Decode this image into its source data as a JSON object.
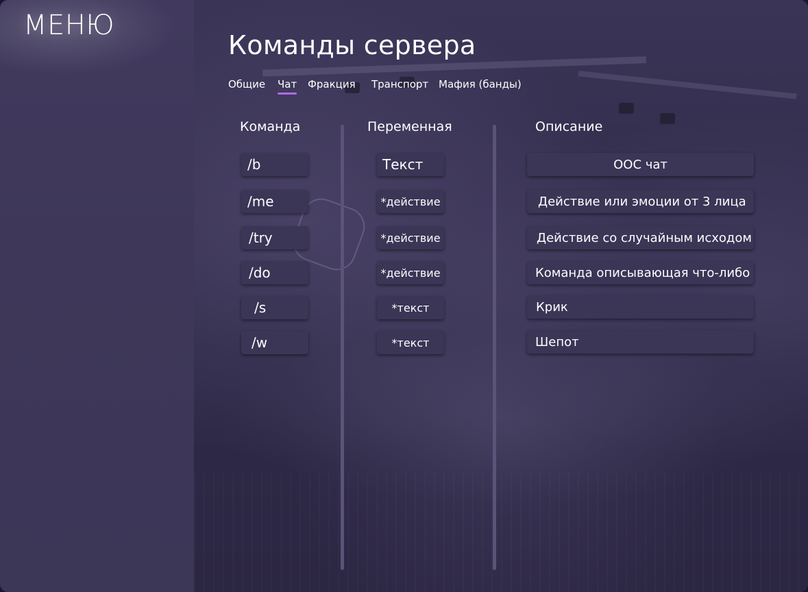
{
  "sidebar": {
    "title": "МЕНЮ"
  },
  "main": {
    "title": "Команды сервера",
    "tabs": [
      {
        "label": "Общие"
      },
      {
        "label": "Чат",
        "active": true
      },
      {
        "label": "Фракция"
      },
      {
        "label": "Транспорт"
      },
      {
        "label": "Мафия (банды)"
      }
    ],
    "columns": {
      "command": "Команда",
      "variable": "Переменная",
      "description": "Описание"
    },
    "rows": [
      {
        "command": "/b",
        "variable": "Текст",
        "description": "ООС чат"
      },
      {
        "command": "/me",
        "variable": "*действие",
        "description": "Действие или эмоции от 3 лица"
      },
      {
        "command": "/try",
        "variable": "*действие",
        "description": "Действие со случайным исходом"
      },
      {
        "command": "/do",
        "variable": "*действие",
        "description": "Команда описывающая что-либо"
      },
      {
        "command": "/s",
        "variable": "*текст",
        "description": "Крик"
      },
      {
        "command": "/w",
        "variable": "*текст",
        "description": "Шепот"
      }
    ]
  },
  "colors": {
    "accent": "#b068f0",
    "sidebar_bg": "#3e3759",
    "cell_bg": "#3b3556"
  }
}
